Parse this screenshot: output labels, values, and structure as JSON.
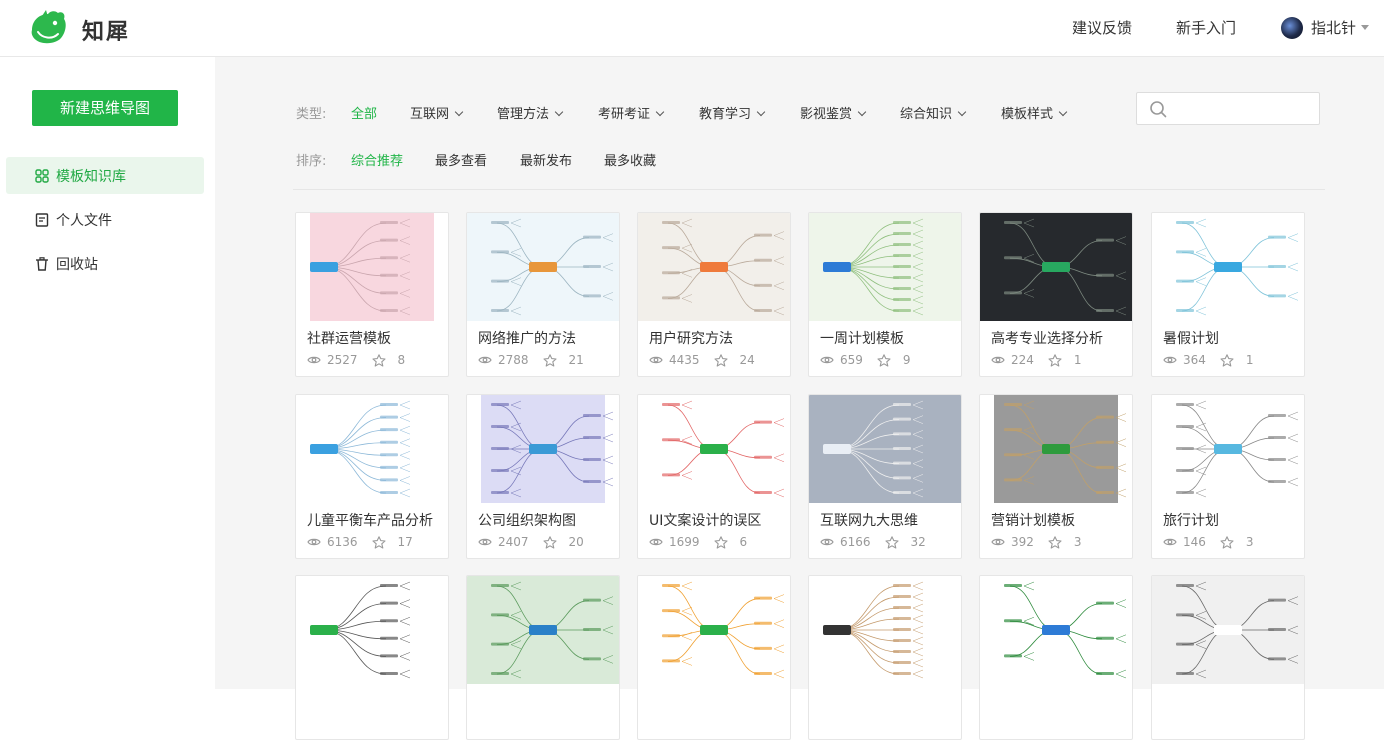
{
  "header": {
    "brand": "知犀",
    "feedback": "建议反馈",
    "guide": "新手入门",
    "user_name": "指北针"
  },
  "sidebar": {
    "new_button": "新建思维导图",
    "items": [
      {
        "label": "模板知识库",
        "icon": "grid-icon",
        "active": true
      },
      {
        "label": "个人文件",
        "icon": "file-icon",
        "active": false
      },
      {
        "label": "回收站",
        "icon": "trash-icon",
        "active": false
      }
    ]
  },
  "filters": {
    "type_label": "类型:",
    "types": [
      {
        "label": "全部",
        "active": true
      },
      {
        "label": "互联网"
      },
      {
        "label": "管理方法"
      },
      {
        "label": "考研考证"
      },
      {
        "label": "教育学习"
      },
      {
        "label": "影视鉴赏"
      },
      {
        "label": "综合知识"
      },
      {
        "label": "模板样式"
      }
    ],
    "sort_label": "排序:",
    "sorts": [
      {
        "label": "综合推荐",
        "active": true
      },
      {
        "label": "最多查看"
      },
      {
        "label": "最新发布"
      },
      {
        "label": "最多收藏"
      }
    ],
    "search_placeholder": ""
  },
  "cards": [
    {
      "title": "社群运营模板",
      "views": "2527",
      "stars": "8",
      "thumb": "pink"
    },
    {
      "title": "网络推广的方法",
      "views": "2788",
      "stars": "21",
      "thumb": "lightblue"
    },
    {
      "title": "用户研究方法",
      "views": "4435",
      "stars": "24",
      "thumb": "beige"
    },
    {
      "title": "一周计划模板",
      "views": "659",
      "stars": "9",
      "thumb": "green"
    },
    {
      "title": "高考专业选择分析",
      "views": "224",
      "stars": "1",
      "thumb": "dark"
    },
    {
      "title": "暑假计划",
      "views": "364",
      "stars": "1",
      "thumb": "white-blue"
    },
    {
      "title": "儿童平衡车产品分析",
      "views": "6136",
      "stars": "17",
      "thumb": "white-multi"
    },
    {
      "title": "公司组织架构图",
      "views": "2407",
      "stars": "20",
      "thumb": "lavender"
    },
    {
      "title": "UI文案设计的误区",
      "views": "1699",
      "stars": "6",
      "thumb": "white-green"
    },
    {
      "title": "互联网九大思维",
      "views": "6166",
      "stars": "32",
      "thumb": "slate"
    },
    {
      "title": "营销计划模板",
      "views": "392",
      "stars": "3",
      "thumb": "gray"
    },
    {
      "title": "旅行计划",
      "views": "146",
      "stars": "3",
      "thumb": "white-green2"
    },
    {
      "title": "",
      "views": "",
      "stars": "",
      "thumb": "white-plain"
    },
    {
      "title": "",
      "views": "",
      "stars": "",
      "thumb": "mint"
    },
    {
      "title": "",
      "views": "",
      "stars": "",
      "thumb": "white-colorful"
    },
    {
      "title": "",
      "views": "",
      "stars": "",
      "thumb": "white-brown"
    },
    {
      "title": "",
      "views": "",
      "stars": "",
      "thumb": "white-greenbox"
    },
    {
      "title": "",
      "views": "",
      "stars": "",
      "thumb": "lightgray"
    }
  ],
  "colors": {
    "accent": "#21b548",
    "active_bg": "#eaf6ec",
    "main_bg": "#f5f5f5"
  }
}
